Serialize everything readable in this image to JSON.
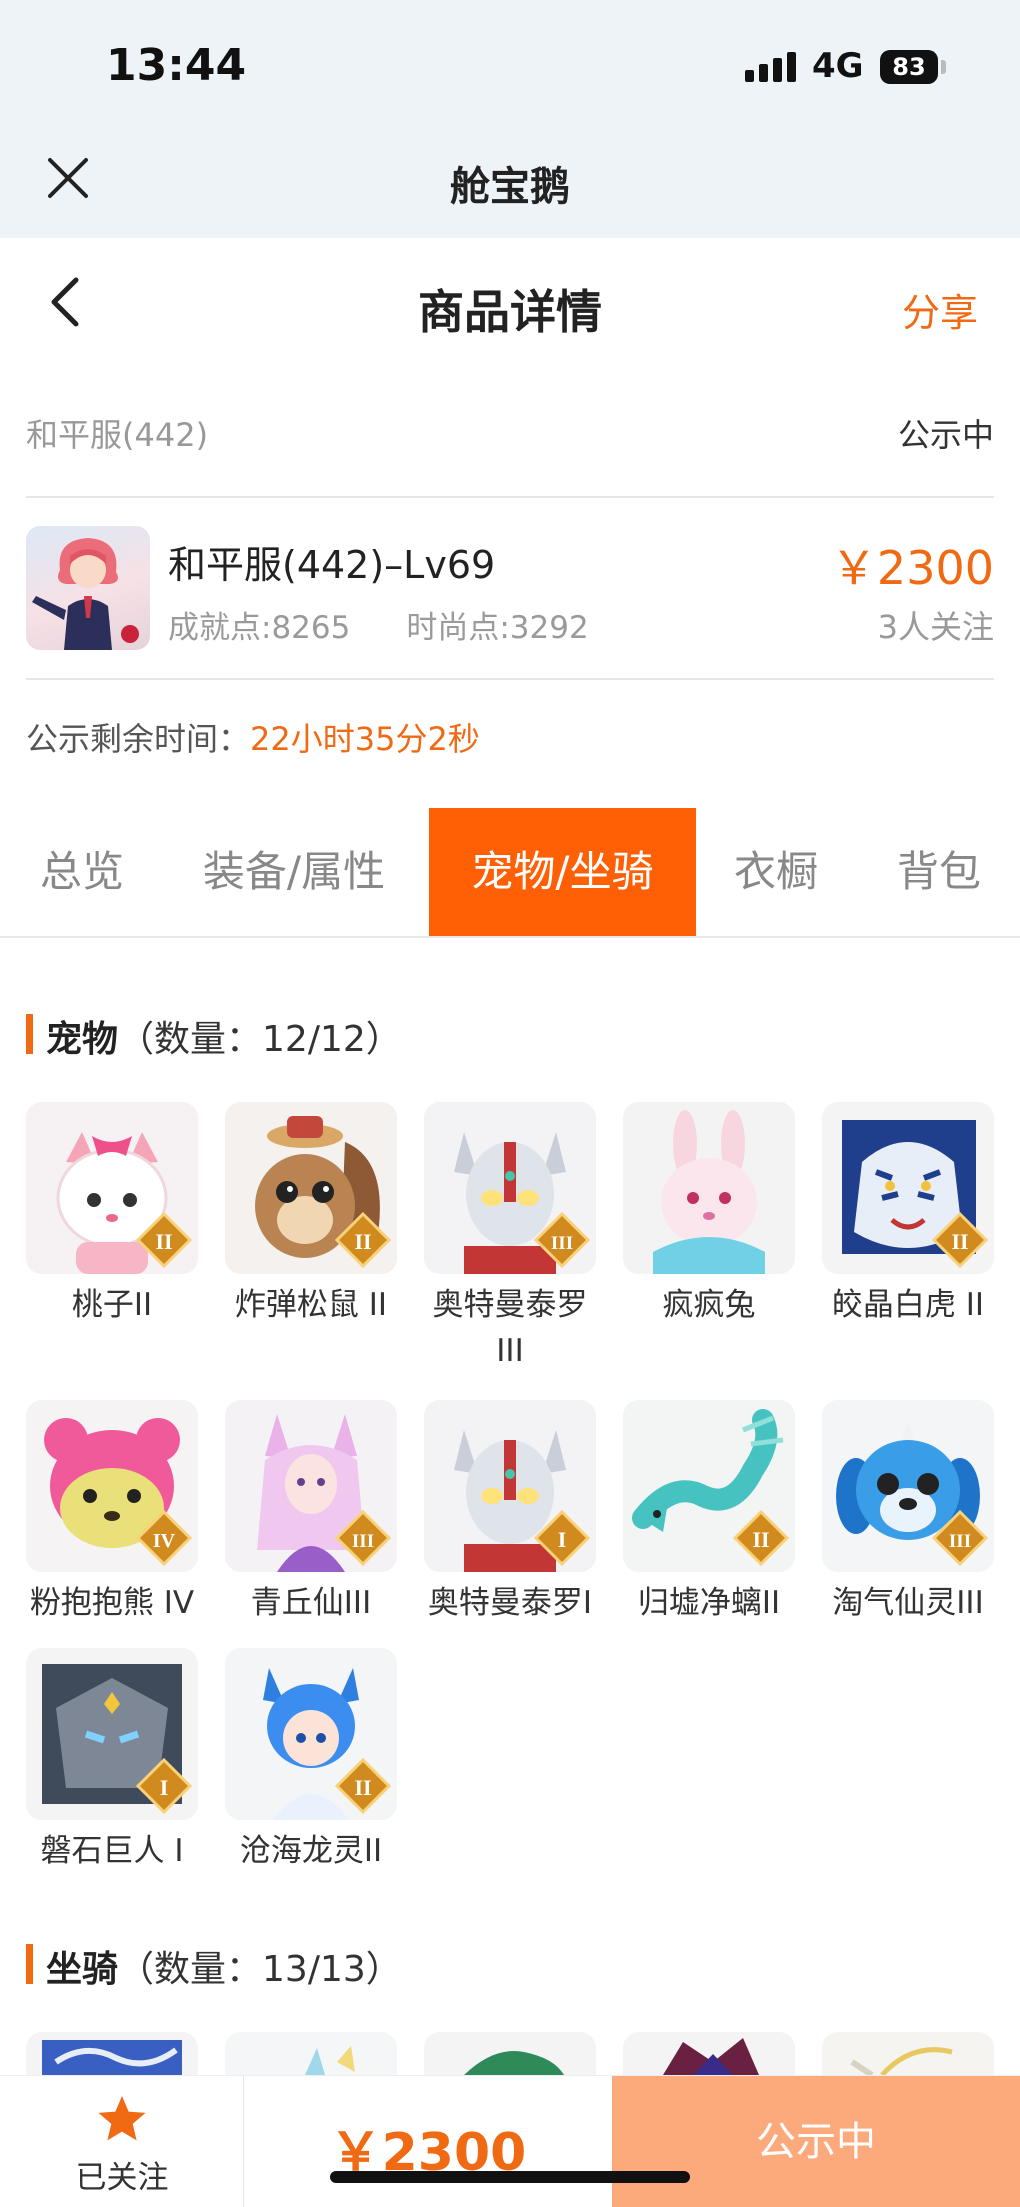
{
  "status_bar": {
    "time": "13:44",
    "network": "4G",
    "battery": "83"
  },
  "app_bar": {
    "title": "舱宝鹅"
  },
  "nav": {
    "title": "商品详情",
    "share": "分享"
  },
  "server": {
    "name": "和平服(442)",
    "status": "公示中"
  },
  "character": {
    "title": "和平服(442)–Lv69",
    "achievement": "成就点:8265",
    "fashion": "时尚点:3292",
    "price": "￥2300",
    "followers": "3人关注"
  },
  "remaining": {
    "label": "公示剩余时间：",
    "value": "22小时35分2秒"
  },
  "tabs": [
    "总览",
    "装备/属性",
    "宠物/坐骑",
    "衣橱",
    "背包"
  ],
  "active_tab": "宠物/坐骑",
  "pets_section": {
    "title": "宠物",
    "count": "（数量：12/12）"
  },
  "pets": [
    {
      "name": "桃子II",
      "rank": "II",
      "icon": "pink-cat-pet"
    },
    {
      "name": "炸弹松鼠 II",
      "rank": "II",
      "icon": "squirrel-pet"
    },
    {
      "name": "奥特曼泰罗III",
      "rank": "III",
      "icon": "ultraman-pet"
    },
    {
      "name": "疯疯兔",
      "rank": "",
      "icon": "rabbit-pet"
    },
    {
      "name": "皎晶白虎 II",
      "rank": "II",
      "icon": "white-tiger-pet"
    },
    {
      "name": "粉抱抱熊 IV",
      "rank": "IV",
      "icon": "pink-bear-pet"
    },
    {
      "name": "青丘仙III",
      "rank": "III",
      "icon": "fox-fairy-pet"
    },
    {
      "name": "奥特曼泰罗I",
      "rank": "I",
      "icon": "ultraman-pet"
    },
    {
      "name": "归墟净螭II",
      "rank": "II",
      "icon": "teal-dragon-pet"
    },
    {
      "name": "淘气仙灵III",
      "rank": "III",
      "icon": "blue-puppy-pet"
    },
    {
      "name": "磐石巨人 I",
      "rank": "I",
      "icon": "stone-giant-pet"
    },
    {
      "name": "沧海龙灵II",
      "rank": "II",
      "icon": "blue-dragon-girl-pet"
    }
  ],
  "mounts_section": {
    "title": "坐骑",
    "count": "（数量：13/13）"
  },
  "bottom_bar": {
    "follow_label": "已关注",
    "price": "￥2300",
    "status_button": "公示中"
  },
  "colors": {
    "accent": "#f06a13",
    "tab_active": "#ff5f05",
    "status_button": "#fca97b",
    "header_bg": "#edf3f6"
  }
}
